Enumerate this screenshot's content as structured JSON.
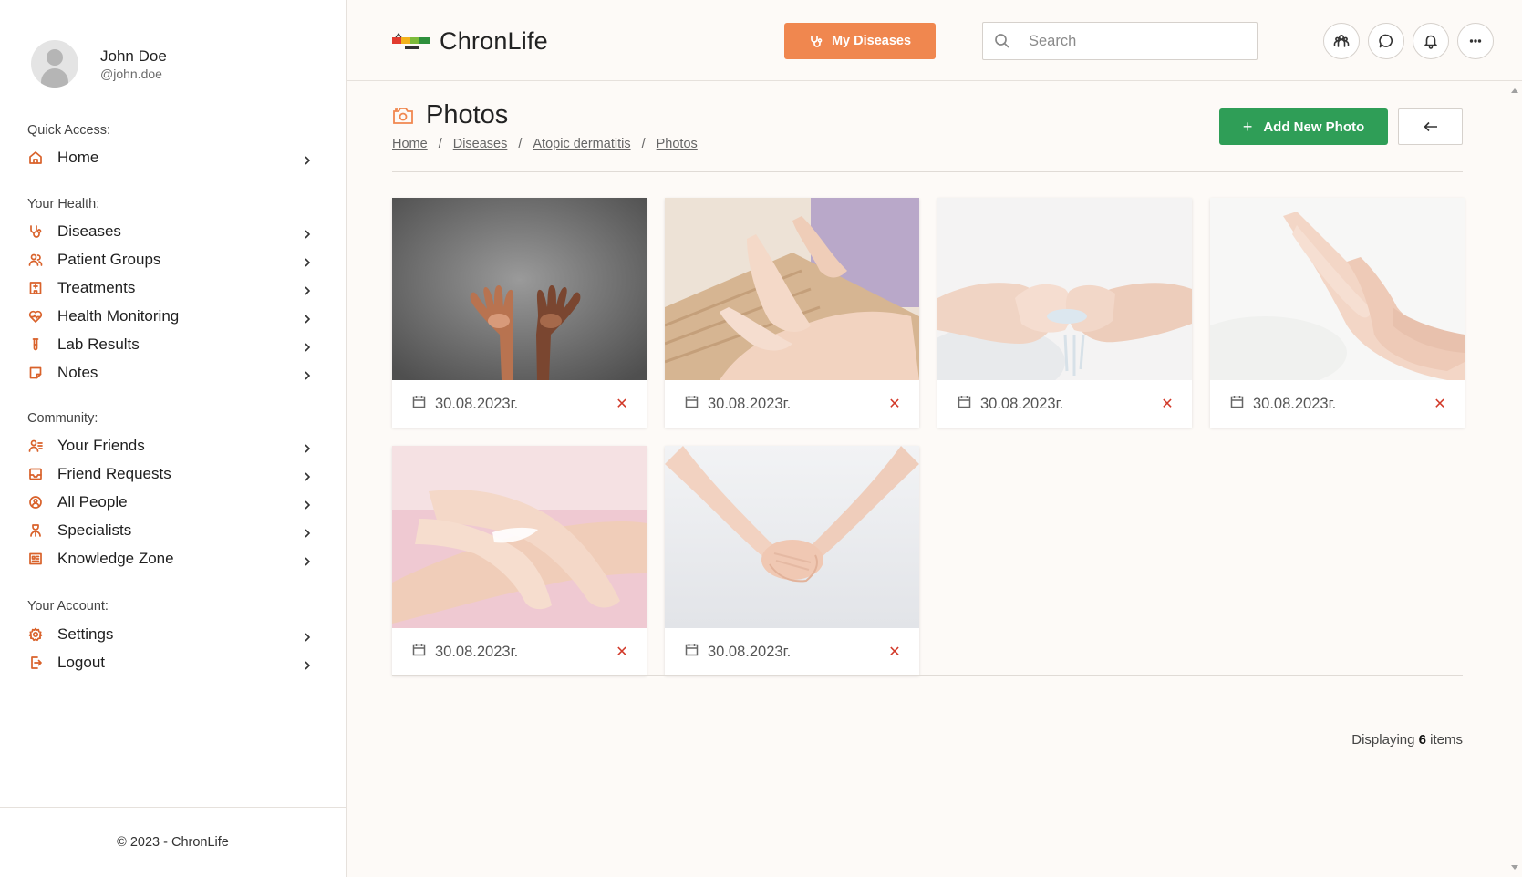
{
  "user": {
    "name": "John Doe",
    "handle": "@john.doe"
  },
  "sidebar": {
    "sections": [
      {
        "title": "Quick Access:",
        "items": [
          {
            "label": "Home",
            "icon": "home-icon"
          }
        ]
      },
      {
        "title": "Your Health:",
        "items": [
          {
            "label": "Diseases",
            "icon": "stethoscope-icon"
          },
          {
            "label": "Patient Groups",
            "icon": "users-icon"
          },
          {
            "label": "Treatments",
            "icon": "hospital-icon"
          },
          {
            "label": "Health Monitoring",
            "icon": "heart-pulse-icon"
          },
          {
            "label": "Lab Results",
            "icon": "test-tube-icon"
          },
          {
            "label": "Notes",
            "icon": "note-icon"
          }
        ]
      },
      {
        "title": "Community:",
        "items": [
          {
            "label": "Your Friends",
            "icon": "user-list-icon"
          },
          {
            "label": "Friend Requests",
            "icon": "inbox-icon"
          },
          {
            "label": "All People",
            "icon": "globe-people-icon"
          },
          {
            "label": "Specialists",
            "icon": "doctor-icon"
          },
          {
            "label": "Knowledge Zone",
            "icon": "book-icon"
          }
        ]
      },
      {
        "title": "Your Account:",
        "items": [
          {
            "label": "Settings",
            "icon": "gear-icon"
          },
          {
            "label": "Logout",
            "icon": "logout-icon"
          }
        ]
      }
    ],
    "footer": "© 2023 - ChronLife"
  },
  "header": {
    "logo_text": "ChronLife",
    "my_diseases_label": "My Diseases",
    "search_placeholder": "Search"
  },
  "page": {
    "title": "Photos",
    "breadcrumb": [
      "Home",
      "Diseases",
      "Atopic dermatitis",
      "Photos"
    ],
    "add_button_label": "Add New Photo",
    "photos": [
      {
        "date": "30.08.2023г.",
        "scene": "open-palms-gray"
      },
      {
        "date": "30.08.2023г.",
        "scene": "cream-hands-wood"
      },
      {
        "date": "30.08.2023г.",
        "scene": "water-cupped-hands"
      },
      {
        "date": "30.08.2023г.",
        "scene": "elegant-hands-white"
      },
      {
        "date": "30.08.2023г.",
        "scene": "cream-hand-pink"
      },
      {
        "date": "30.08.2023г.",
        "scene": "clasped-hands-light"
      }
    ],
    "count_prefix": "Displaying",
    "count_value": "6",
    "count_suffix": "items"
  },
  "colors": {
    "accent": "#f0874f",
    "icon": "#d9622b",
    "success": "#2f9e57",
    "danger": "#d23a2a"
  }
}
